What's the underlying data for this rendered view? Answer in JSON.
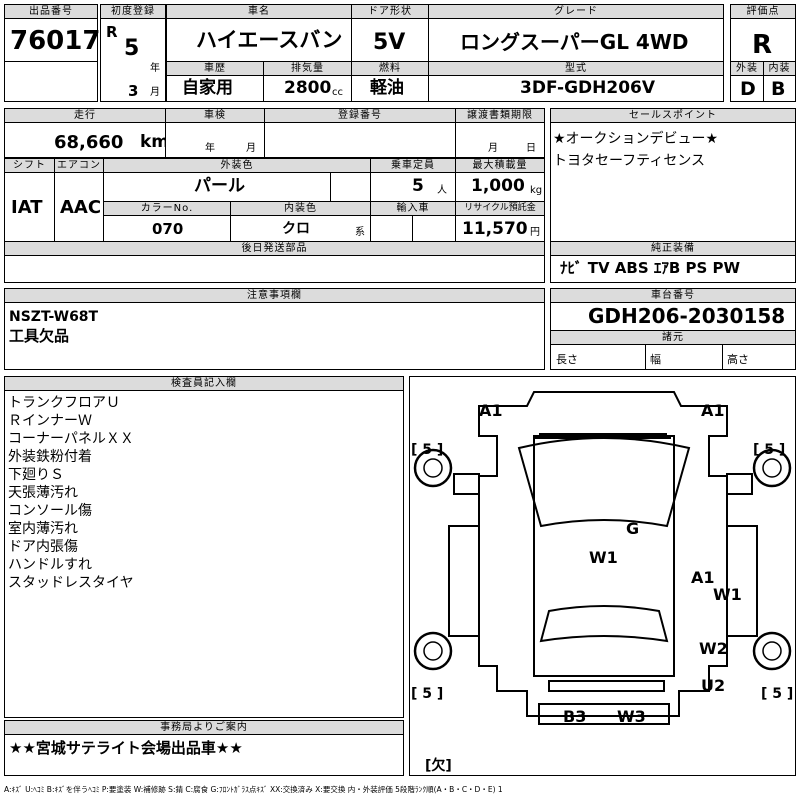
{
  "header": {
    "lot_label": "出品番号",
    "lot_number": "76017",
    "first_reg_label": "初度登録",
    "era": "R",
    "reg_year": "5",
    "year_unit": "年",
    "reg_month": "3",
    "month_unit": "月",
    "model_label": "車名",
    "model": "ハイエースバン",
    "door_label": "ドア形状",
    "door": "5V",
    "grade_label": "グレード",
    "grade": "ロングスーパーGL 4WD",
    "score_label": "評価点",
    "score": "R",
    "history_label": "車歴",
    "history": "自家用",
    "displacement_label": "排気量",
    "displacement": "2800",
    "cc_unit": "cc",
    "fuel_label": "燃料",
    "fuel": "軽油",
    "type_label": "型式",
    "type": "3DF-GDH206V",
    "exterior_label": "外装",
    "exterior_grade": "D",
    "interior_label": "内装",
    "interior_grade": "B"
  },
  "row2": {
    "mileage_label": "走行",
    "mileage": "68,660",
    "mileage_unit": "km",
    "inspection_label": "車検",
    "year_unit": "年",
    "month_unit": "月",
    "reg_no_label": "登録番号",
    "transfer_label": "譲渡書類期限",
    "transfer_month": "月",
    "transfer_day": "日",
    "sales_label": "セールスポイント",
    "sales_points": [
      "★オークションデビュー★",
      "トヨタセーフティセンス"
    ]
  },
  "row3": {
    "shift_label": "シフト",
    "shift": "IAT",
    "ac_label": "エアコン",
    "ac": "AAC",
    "color_label": "外装色",
    "color": "パール",
    "capacity_label": "乗車定員",
    "capacity": "5",
    "capacity_unit": "人",
    "load_label": "最大積載量",
    "load": "1,000",
    "load_unit": "kg",
    "color_no_label": "カラーNo.",
    "color_no": "070",
    "int_color_label": "内装色",
    "int_color": "クロ",
    "int_color_unit": "系",
    "import_label": "輸入車",
    "recycle_label": "リサイクル預託金",
    "recycle": "11,570",
    "recycle_unit": "円",
    "later_label": "後日発送部品",
    "equip_label": "純正装備",
    "equipment": "ﾅﾋﾞ TV ABS ｴｱB PS PW"
  },
  "caution": {
    "label": "注意事項欄",
    "lines": [
      "NSZT-W68T",
      "工具欠品"
    ],
    "chassis_label": "車台番号",
    "chassis": "GDH206-2030158",
    "spec_label": "諸元",
    "length_label": "長さ",
    "width_label": "幅",
    "height_label": "高さ"
  },
  "inspector": {
    "label": "検査員記入欄",
    "notes": [
      "トランクフロアＵ",
      "ＲインナーＷ",
      "コーナーパネルＸＸ",
      "外装鉄粉付着",
      "下廻りＳ",
      "天張薄汚れ",
      "コンソール傷",
      "室内薄汚れ",
      "ドア内張傷",
      "ハンドルすれ",
      "スタッドレスタイヤ"
    ]
  },
  "office": {
    "label": "事務局よりご案内",
    "message": "★★宮城サテライト会場出品車★★"
  },
  "diagram": {
    "marks": {
      "a1_left": "A1",
      "a1_right": "A1",
      "g": "G",
      "w1_center": "W1",
      "a1_side": "A1",
      "w1_side": "W1",
      "w2": "W2",
      "u2": "U2",
      "b3": "B3",
      "w3": "W3"
    },
    "tire_tl": "[ 5 ]",
    "tire_tr": "[ 5 ]",
    "tire_bl": "[ 5 ]",
    "tire_br": "[ 5 ]",
    "spare": "[欠]"
  },
  "legend": "A:ｷｽﾞ U:ﾍｺﾐ B:ｷｽﾞを伴うﾍｺﾐ P:要塗装 W:補修跡 S:錆 C:腐食 G:ﾌﾛﾝﾄｶﾞﾗｽ点ｷｽﾞ XX:交換済み X:要交換 内・外装評価 5段階ﾗﾝｸ順(A・B・C・D・E) 1"
}
